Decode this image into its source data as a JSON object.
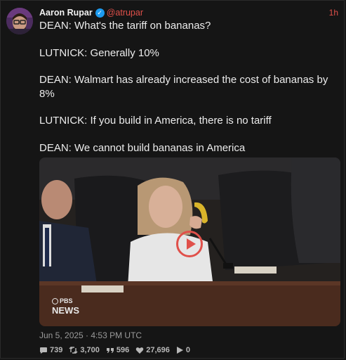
{
  "author": {
    "name": "Aaron Rupar",
    "handle": "@atrupar",
    "relative_time": "1h"
  },
  "tweet": {
    "lines": [
      "DEAN: What's the tariff on bananas?",
      "LUTNICK: Generally 10%",
      "DEAN: Walmart has already increased the cost of bananas by 8%",
      "LUTNICK: If you build in America, there is no tariff",
      "DEAN: We cannot build bananas in America"
    ]
  },
  "media": {
    "logo_top": "PBS",
    "logo_bottom": "NEWS"
  },
  "meta": {
    "date": "Jun 5, 2025 · 4:53 PM UTC"
  },
  "stats": {
    "replies": "739",
    "retweets": "3,700",
    "quotes": "596",
    "likes": "27,696",
    "views": "0"
  },
  "colors": {
    "accent": "#e0504a",
    "verified": "#1d9bf0",
    "background": "#151515"
  }
}
